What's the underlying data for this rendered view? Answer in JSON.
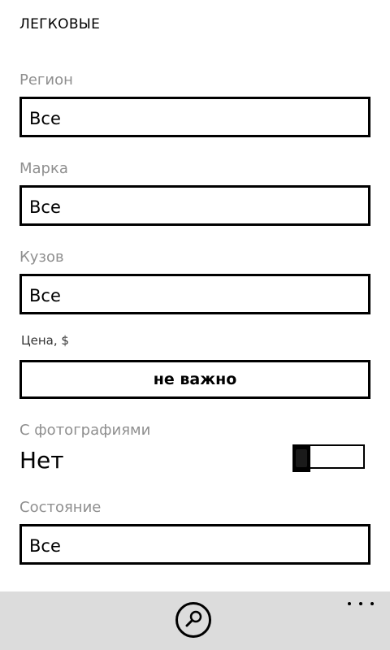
{
  "header": {
    "title": "ЛЕГКОВЫЕ"
  },
  "filters": {
    "region": {
      "label": "Регион",
      "value": "Все"
    },
    "brand": {
      "label": "Марка",
      "value": "Все"
    },
    "body": {
      "label": "Кузов",
      "value": "Все"
    },
    "price": {
      "label": "Цена, $",
      "value": "не важно"
    },
    "photos": {
      "label": "С фотографиями",
      "state": "Нет",
      "enabled": false
    },
    "condition": {
      "label": "Состояние",
      "value": "Все"
    }
  },
  "app_bar": {
    "buttons": [
      "search-icon",
      "more-icon"
    ]
  }
}
